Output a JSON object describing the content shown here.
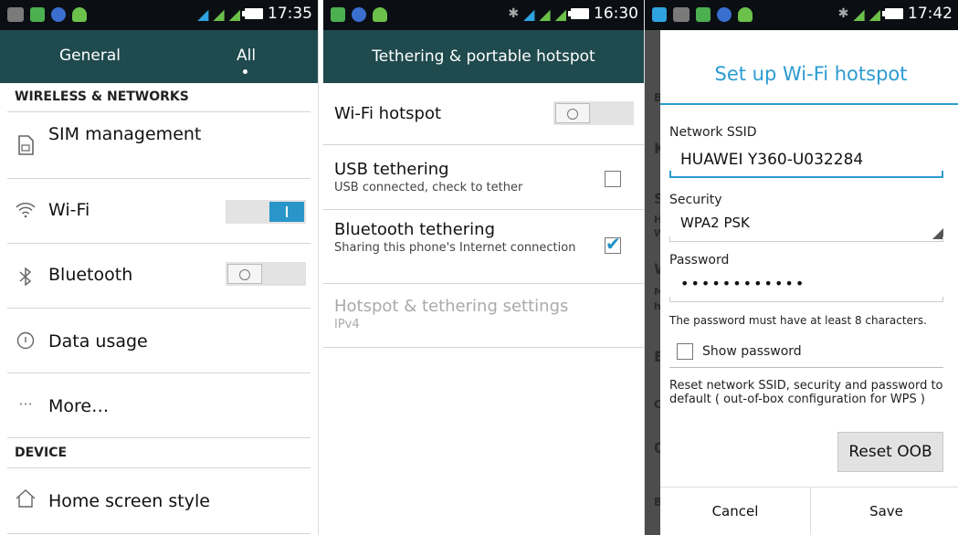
{
  "panel1": {
    "status": {
      "time": "17:35"
    },
    "tabs": [
      "General",
      "All"
    ],
    "sections": [
      {
        "header": "WIRELESS & NETWORKS"
      },
      {
        "header": "DEVICE"
      }
    ],
    "rows": [
      {
        "label": "SIM management",
        "icon": "sim-card-icon"
      },
      {
        "label": "Wi-Fi",
        "icon": "wifi-icon",
        "toggle": "on"
      },
      {
        "label": "Bluetooth",
        "icon": "bluetooth-icon",
        "toggle": "off"
      },
      {
        "label": "Data usage",
        "icon": "data-usage-icon"
      },
      {
        "label": "More…",
        "icon": "more-dots-icon"
      },
      {
        "label": "Home screen style",
        "icon": "home-icon"
      }
    ]
  },
  "panel2": {
    "status": {
      "time": "16:30"
    },
    "title": "Tethering & portable hotspot",
    "items": [
      {
        "title": "Wi-Fi hotspot",
        "toggle": "off"
      },
      {
        "title": "USB tethering",
        "subtitle": "USB connected, check to tether",
        "checked": false
      },
      {
        "title": "Bluetooth tethering",
        "subtitle": "Sharing this phone's Internet connection",
        "checked": true
      },
      {
        "title": "Hotspot & tethering settings",
        "subtitle": "IPv4",
        "disabled": true
      }
    ]
  },
  "panel3": {
    "status": {
      "time": "17:42"
    },
    "background_letters": [
      "B",
      "K",
      "S",
      "H",
      "W",
      "W",
      "M",
      "h",
      "E",
      "C",
      "0",
      "B"
    ],
    "dialog": {
      "title": "Set up Wi-Fi hotspot",
      "ssid_label": "Network SSID",
      "ssid_value": "HUAWEI Y360-U032284",
      "security_label": "Security",
      "security_value": "WPA2 PSK",
      "password_label": "Password",
      "password_value": "••••••••••••",
      "password_hint": "The password must have at least 8 characters.",
      "show_password_label": "Show password",
      "reset_text": "Reset network SSID, security and password to default ( out-of-box configuration for WPS )",
      "reset_button": "Reset OOB",
      "cancel_button": "Cancel",
      "save_button": "Save"
    }
  },
  "colors": {
    "status_bar": "#0b0f14",
    "app_bar": "#1f4a4e",
    "accent": "#2c9bd1",
    "toggle_on": "#2a95c8"
  }
}
